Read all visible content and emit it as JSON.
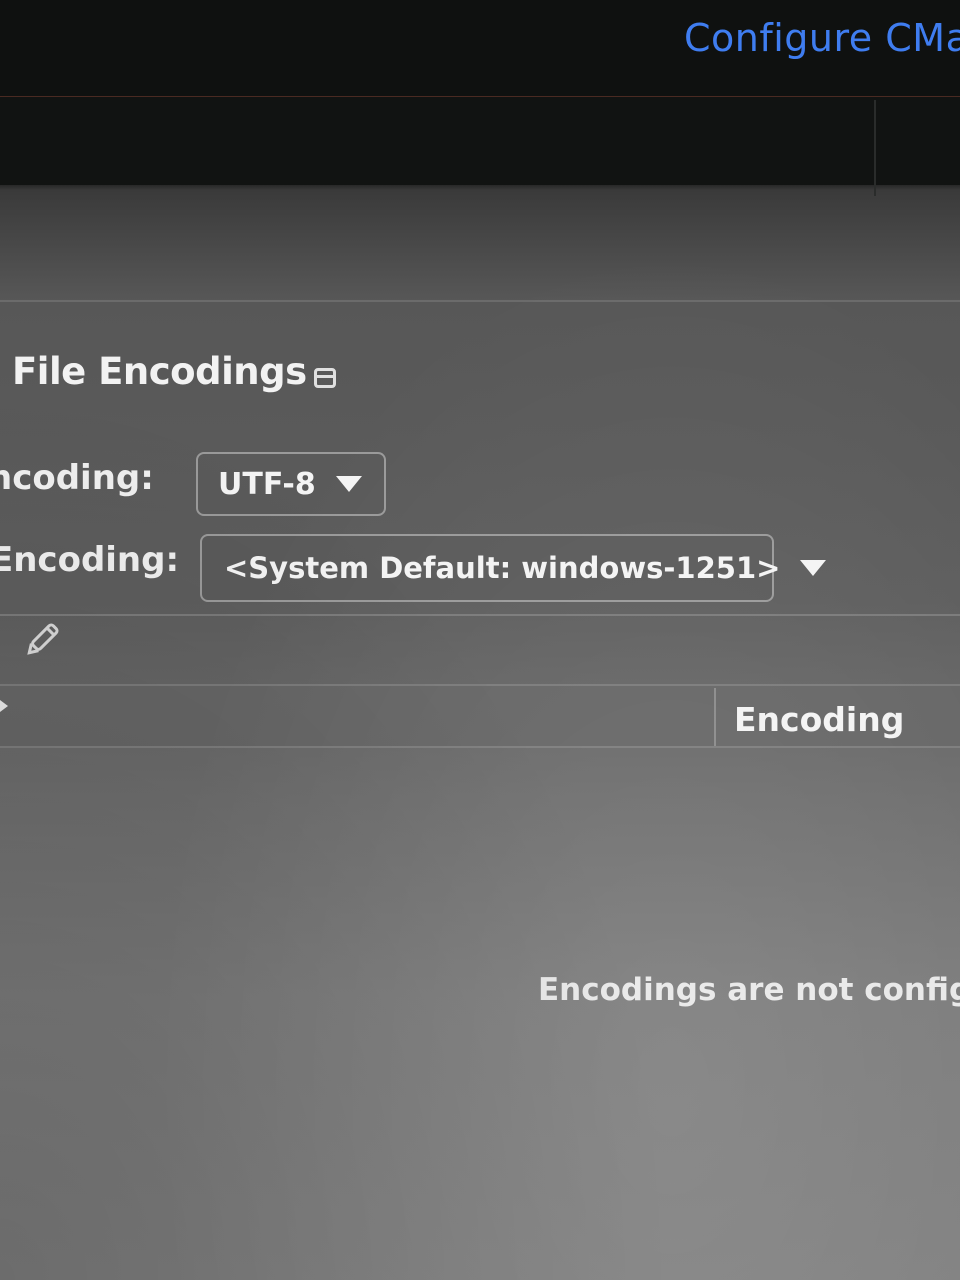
{
  "window": {
    "link_text": "Configure CMa"
  },
  "section": {
    "title": "File Encodings"
  },
  "global_encoding": {
    "label": "ncoding:",
    "value": "UTF-8"
  },
  "project_encoding": {
    "label": "Encoding:",
    "value": "<System Default: windows-1251>"
  },
  "toolbar": {
    "edit_icon": "pencil-icon"
  },
  "table": {
    "columns": [
      "Encoding"
    ],
    "empty_text": "Encodings are not configu"
  },
  "colors": {
    "link": "#3f7df0",
    "text": "#f2f2f2",
    "panel": "#5d5d5d"
  }
}
